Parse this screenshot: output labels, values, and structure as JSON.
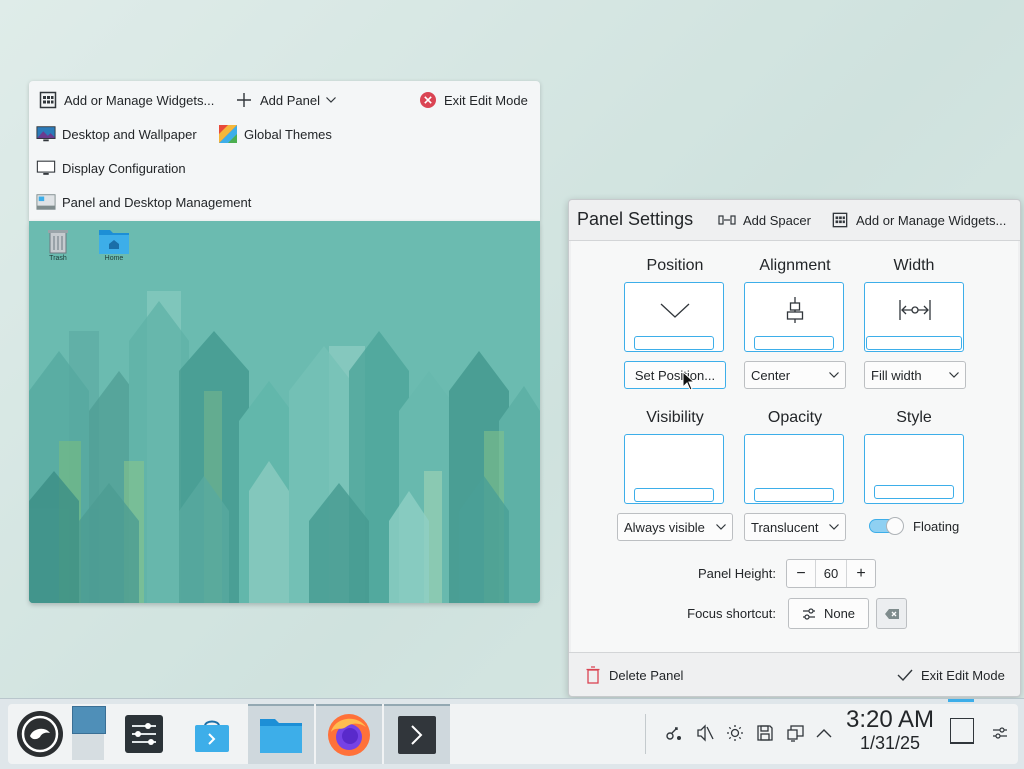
{
  "toolbar": {
    "add_widgets_label": "Add or Manage Widgets...",
    "add_panel_label": "Add Panel",
    "exit_edit_label": "Exit Edit Mode",
    "desktop_wallpaper_label": "Desktop and Wallpaper",
    "global_themes_label": "Global Themes",
    "display_config_label": "Display Configuration",
    "panel_desktop_mgmt_label": "Panel and Desktop Management"
  },
  "desktop": {
    "icons": [
      {
        "label": "Trash",
        "icon": "trash-icon"
      },
      {
        "label": "Home",
        "icon": "home-folder-icon"
      }
    ]
  },
  "panel_settings": {
    "title": "Panel Settings",
    "add_spacer_label": "Add Spacer",
    "add_widgets_label": "Add or Manage Widgets...",
    "position": {
      "title": "Position",
      "button_label": "Set Position..."
    },
    "alignment": {
      "title": "Alignment",
      "value": "Center"
    },
    "width": {
      "title": "Width",
      "value": "Fill width"
    },
    "visibility": {
      "title": "Visibility",
      "value": "Always visible"
    },
    "opacity": {
      "title": "Opacity",
      "value": "Translucent"
    },
    "style": {
      "title": "Style",
      "toggle_label": "Floating",
      "floating": true
    },
    "panel_height": {
      "label": "Panel Height:",
      "value": "60",
      "minus": "−",
      "plus": "+"
    },
    "focus_shortcut": {
      "label": "Focus shortcut:",
      "value": "None"
    },
    "delete_panel_label": "Delete Panel",
    "exit_edit_label": "Exit Edit Mode"
  },
  "taskbar": {
    "apps": [
      "opensuse-launcher-icon",
      "pager-icon",
      "system-settings-icon",
      "discover-store-icon",
      "dolphin-files-icon",
      "firefox-icon",
      "konsole-terminal-icon"
    ],
    "tray": [
      "network-icon",
      "volume-muted-icon",
      "brightness-icon",
      "storage-icon",
      "clipboard-icon",
      "tray-expand-icon"
    ],
    "clock": {
      "time": "3:20 AM",
      "date": "1/31/25"
    }
  },
  "colors": {
    "accent": "#3daee9",
    "desktop_bg": "#6fbcb0",
    "danger": "#da4453"
  }
}
